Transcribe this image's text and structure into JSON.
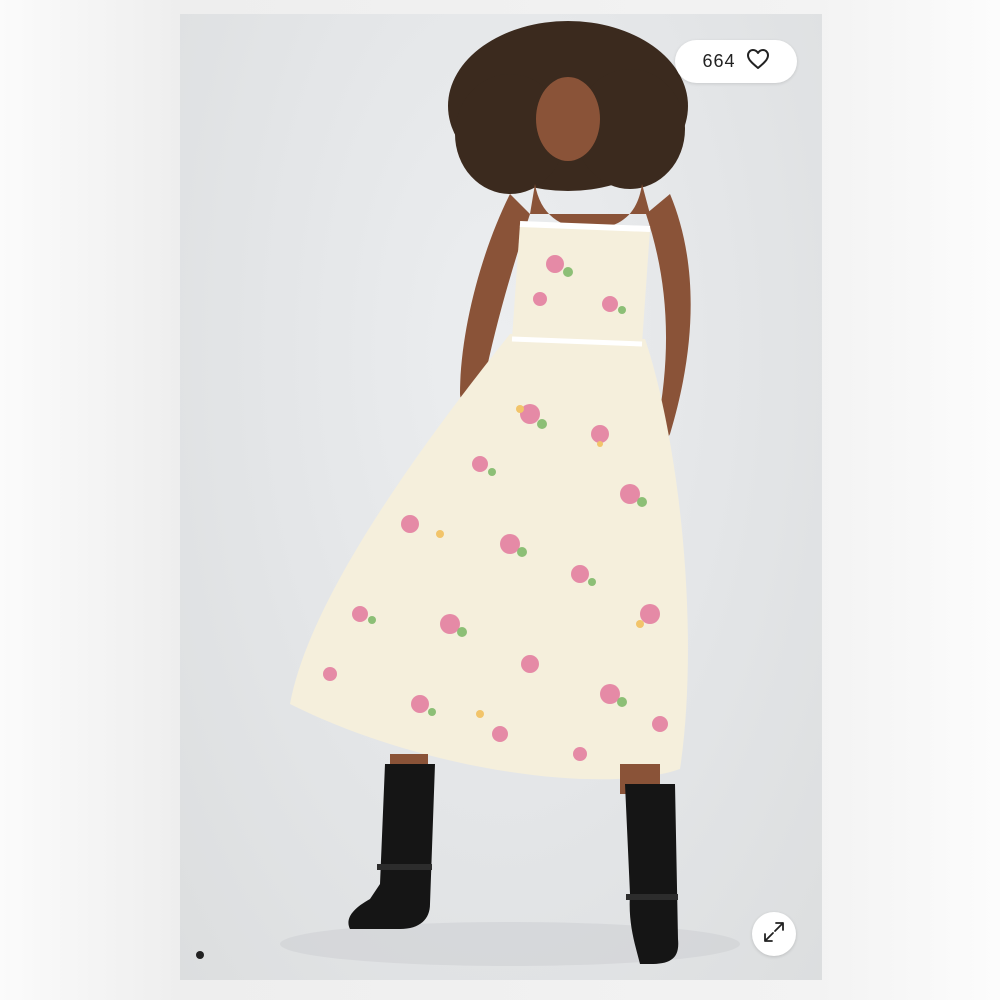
{
  "listing": {
    "like_count": "664",
    "icons": {
      "like": "heart-icon",
      "expand": "expand-arrows-icon"
    },
    "carousel": {
      "current_index": 1
    },
    "colors": {
      "backdrop": "#e4e6e8",
      "dress": "#f5efdc",
      "rose": "#e58aa6",
      "leaf": "#8cbf76",
      "boots": "#151515",
      "skin": "#8a5338",
      "hair": "#3b2a1e"
    }
  }
}
